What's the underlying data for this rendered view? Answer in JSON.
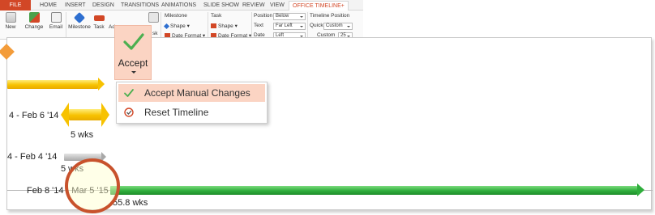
{
  "ribbon": {
    "tabs": [
      "FILE",
      "HOME",
      "INSERT",
      "DESIGN",
      "TRANSITIONS",
      "ANIMATIONS",
      "SLIDE SHOW",
      "REVIEW",
      "VIEW",
      "OFFICE TIMELINE+"
    ],
    "active_tab": "OFFICE TIMELINE+",
    "buttons": {
      "new": "New",
      "change": "Change",
      "email": "Email",
      "milestone": "Milestone",
      "task": "Task",
      "ad": "Ad"
    },
    "milestone_group": {
      "title": "Milestone",
      "shape": "Shape",
      "date_format": "Date Format"
    },
    "task_group": {
      "title": "Task",
      "shape": "Shape",
      "date_format": "Date Format"
    },
    "position_group": {
      "position_label": "Position",
      "position_value": "Below",
      "text_label": "Text",
      "text_value": "Far Left",
      "date_label": "Date",
      "date_value": "Left"
    },
    "timeline_position": {
      "title": "Timeline Position",
      "quick_label": "Quick",
      "quick_value": "Custom",
      "custom_label": "Custom",
      "custom_value": "25"
    },
    "fragment_text": "sk"
  },
  "accept_button": {
    "label": "Accept",
    "icon": "checkmark-icon"
  },
  "menu": {
    "items": [
      {
        "label": "Accept Manual Changes",
        "icon": "checkmark-icon",
        "highlighted": true
      },
      {
        "label": "Reset Timeline",
        "icon": "reset-icon",
        "highlighted": false
      }
    ]
  },
  "timeline": {
    "tasks": [
      {
        "date_range": "4 - Feb 6 '14",
        "duration": "5 wks",
        "color": "#f7c200"
      },
      {
        "date_range": "4 - Feb 4 '14",
        "duration": "5 wks",
        "color": "#b0b0b0"
      },
      {
        "date_range": "Feb 8 '14 - Mar 5 '15",
        "duration": "55.8 wks",
        "color": "#2fae3c"
      }
    ]
  },
  "colors": {
    "accent": "#d24726",
    "highlight": "#fbd4c3",
    "circle": "#c8522c"
  }
}
